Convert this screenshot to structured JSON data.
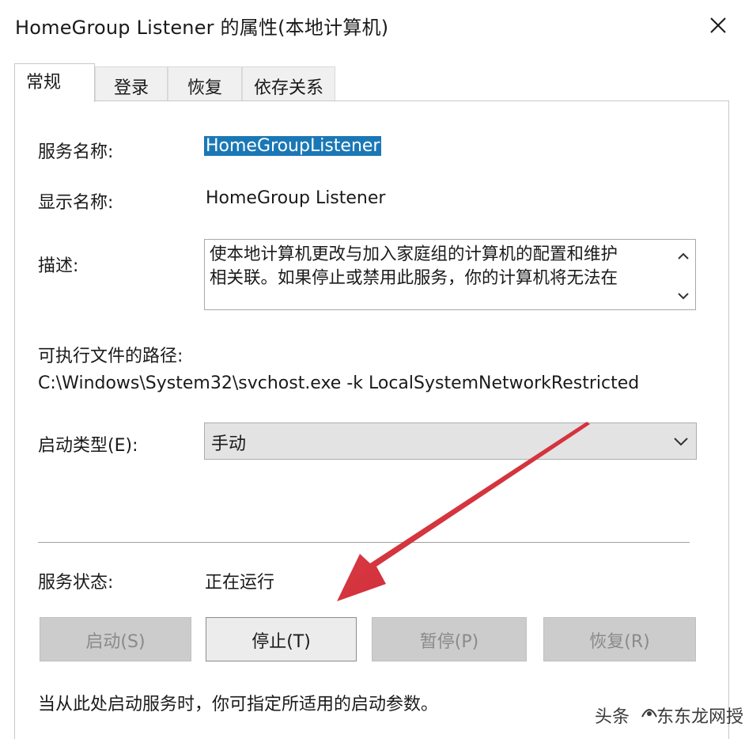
{
  "window": {
    "title": "HomeGroup Listener 的属性(本地计算机)",
    "close_icon": "close-icon"
  },
  "tabs": [
    {
      "label": "常规",
      "active": true
    },
    {
      "label": "登录",
      "active": false
    },
    {
      "label": "恢复",
      "active": false
    },
    {
      "label": "依存关系",
      "active": false
    }
  ],
  "general": {
    "service_name_label": "服务名称:",
    "service_name_value": "HomeGroupListener",
    "display_name_label": "显示名称:",
    "display_name_value": "HomeGroup Listener",
    "description_label": "描述:",
    "description_lines": [
      "使本地计算机更改与加入家庭组的计算机的配置和维护",
      "相关联。如果停止或禁用此服务，你的计算机将无法在"
    ],
    "exe_path_label": "可执行文件的路径:",
    "exe_path_value": "C:\\Windows\\System32\\svchost.exe -k LocalSystemNetworkRestricted",
    "startup_type_label": "启动类型(E):",
    "startup_type_value": "手动",
    "service_status_label": "服务状态:",
    "service_status_value": "正在运行"
  },
  "buttons": {
    "start": {
      "label": "启动(S)",
      "enabled": false
    },
    "stop": {
      "label": "停止(T)",
      "enabled": true
    },
    "pause": {
      "label": "暂停(P)",
      "enabled": false
    },
    "resume": {
      "label": "恢复(R)",
      "enabled": false
    }
  },
  "hint_text": "当从此处启动服务时，你可指定所适用的启动参数。",
  "watermark": {
    "prefix": "头条",
    "name": "东东龙网授"
  },
  "colors": {
    "selection": "#1b78b6",
    "annotation_arrow": "#d8323a"
  }
}
